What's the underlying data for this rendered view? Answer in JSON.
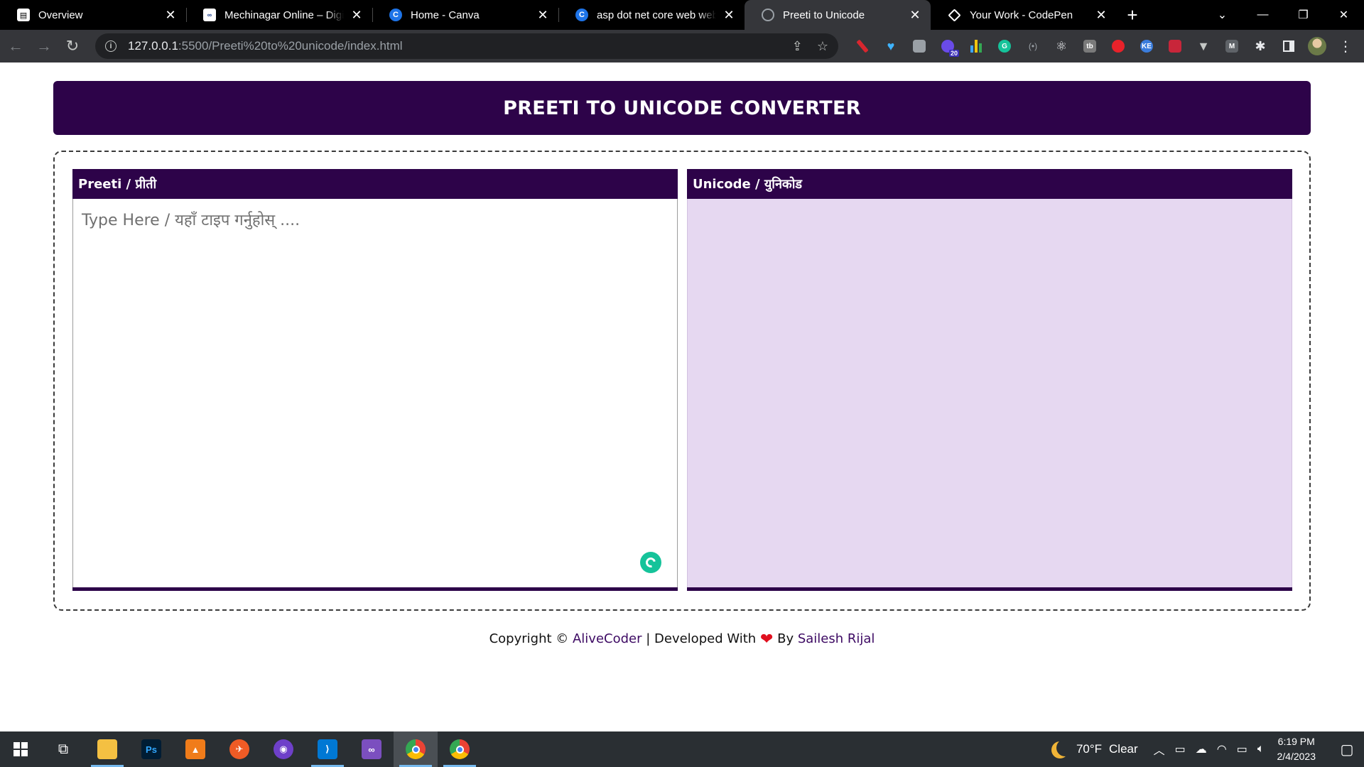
{
  "browser": {
    "tabs": [
      {
        "title": "Overview",
        "icon": "overview-icon",
        "active": false
      },
      {
        "title": "Mechinagar Online – Digital",
        "icon": "mechinagar-icon",
        "active": false
      },
      {
        "title": "Home - Canva",
        "icon": "canva-icon",
        "active": false
      },
      {
        "title": "asp dot net core web web api",
        "icon": "canva-icon",
        "active": false
      },
      {
        "title": "Preeti to Unicode",
        "icon": "globe-icon",
        "active": true
      },
      {
        "title": "Your Work - CodePen",
        "icon": "codepen-icon",
        "active": false
      }
    ],
    "new_tab_glyph": "+",
    "close_glyph": "✕",
    "address": {
      "host": "127.0.0.1",
      "rest": ":5500/Preeti%20to%20unicode/index.html"
    },
    "extension_badge": "20",
    "ext_labels": {
      "g": "G",
      "tb": "tb",
      "ke": "KE",
      "m": "M"
    }
  },
  "page": {
    "title": "PREETI TO UNICODE CONVERTER",
    "left_panel": {
      "label": "Preeti / प्रीती",
      "placeholder": "Type Here / यहाँ टाइप गर्नुहोस् ...."
    },
    "right_panel": {
      "label": "Unicode / युनिकोड",
      "value": ""
    },
    "footer": {
      "copyright": "Copyright © ",
      "brand": "AliveCoder",
      "separator": " | Developed With ",
      "heart": "❤",
      "by": " By ",
      "author": "Sailesh Rijal"
    }
  },
  "taskbar": {
    "apps": [
      "file-explorer",
      "photoshop",
      "app-orange",
      "postman",
      "github-desktop",
      "vscode",
      "visual-studio",
      "chrome",
      "chrome-profile"
    ],
    "weather": {
      "temp": "70°F",
      "condition": "Clear"
    },
    "clock": {
      "time": "6:19 PM",
      "date": "2/4/2023"
    }
  },
  "colors": {
    "brand": "#2d0349",
    "output_bg": "#e6d8f1",
    "heart": "#e0101f"
  }
}
